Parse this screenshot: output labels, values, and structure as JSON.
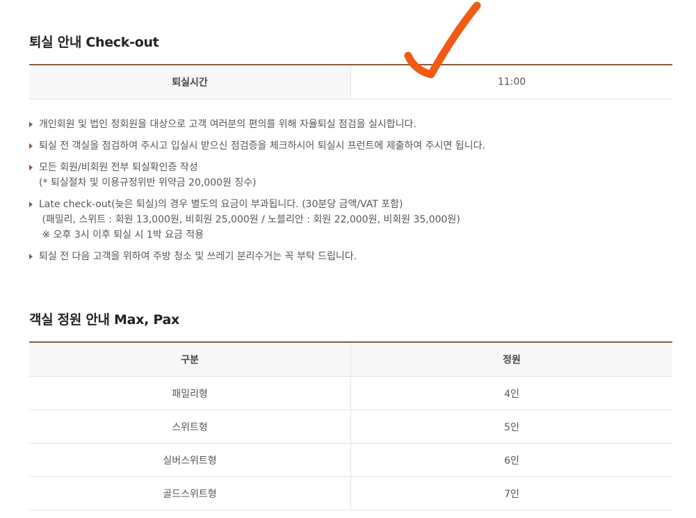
{
  "checkout": {
    "title": "퇴실 안내 Check-out",
    "row_label": "퇴실시간",
    "row_value": "11:00",
    "notes": [
      {
        "lines": [
          "개인회원 및 법인 정회원을 대상으로 고객 여러분의 편의를 위해 자율퇴실 점검을 실시합니다."
        ]
      },
      {
        "lines": [
          "퇴실 전 객실을 점검하여 주시고 입실시 받으신 점검증을 체크하시어 퇴실시 프런트에 제출하여 주시면 됩니다."
        ]
      },
      {
        "lines": [
          "모든 회원/비회원 전부 퇴실확인증 작성",
          "(* 퇴실절차 및 이용규정위반 위약금 20,000원 징수)"
        ]
      },
      {
        "lines": [
          "Late check-out(늦은 퇴실)의 경우 별도의 요금이 부과됩니다. (30분당 금액/VAT 포함)",
          " (패밀리, 스위트 : 회원 13,000원, 비회원 25,000원 / 노블리안 : 회원 22,000원, 비회원 35,000원)",
          " ※ 오후 3시 이후 퇴실 시 1박 요금 적용"
        ]
      },
      {
        "lines": [
          "퇴실 전 다음 고객을 위하여 주방 청소 및 쓰레기 분리수거는 꼭 부탁 드립니다."
        ]
      }
    ]
  },
  "capacity": {
    "title": "객실 정원 안내 Max, Pax",
    "headers": [
      "구분",
      "정원"
    ],
    "rows": [
      [
        "패밀리형",
        "4인"
      ],
      [
        "스위트형",
        "5인"
      ],
      [
        "실버스위트형",
        "6인"
      ],
      [
        "골드스위트형",
        "7인"
      ]
    ]
  },
  "colors": {
    "accent": "#8b5a3c",
    "checkmark": "#f05a14",
    "header_bg": "#f7f7f7",
    "border": "#e2e2e2"
  },
  "icons": {
    "annotation": "checkmark-icon",
    "bullet": "triangle-bullet-icon"
  }
}
